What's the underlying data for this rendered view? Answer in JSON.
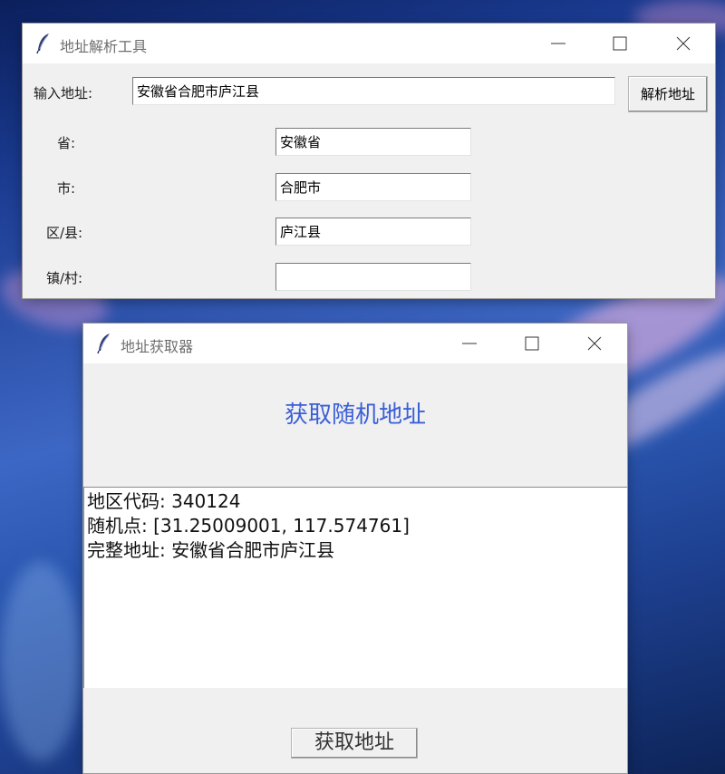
{
  "window1": {
    "title": "地址解析工具",
    "input_label": "输入地址:",
    "input_value": "安徽省合肥市庐江县",
    "parse_button": "解析地址",
    "fields": [
      {
        "label": "省:",
        "value": "安徽省"
      },
      {
        "label": "市:",
        "value": "合肥市"
      },
      {
        "label": "区/县:",
        "value": "庐江县"
      },
      {
        "label": "镇/村:",
        "value": ""
      }
    ]
  },
  "window2": {
    "title": "地址获取器",
    "heading": "获取随机地址",
    "output_lines": [
      "地区代码: 340124",
      "随机点: [31.25009001, 117.574761]",
      "完整地址: 安徽省合肥市庐江县"
    ],
    "get_button": "获取地址"
  },
  "colors": {
    "heading": "#3b5fd6",
    "window_bg": "#f0f0f0",
    "titlebar_bg": "#ffffff"
  },
  "icons": [
    "feather-icon",
    "minimize-icon",
    "maximize-icon",
    "close-icon"
  ]
}
